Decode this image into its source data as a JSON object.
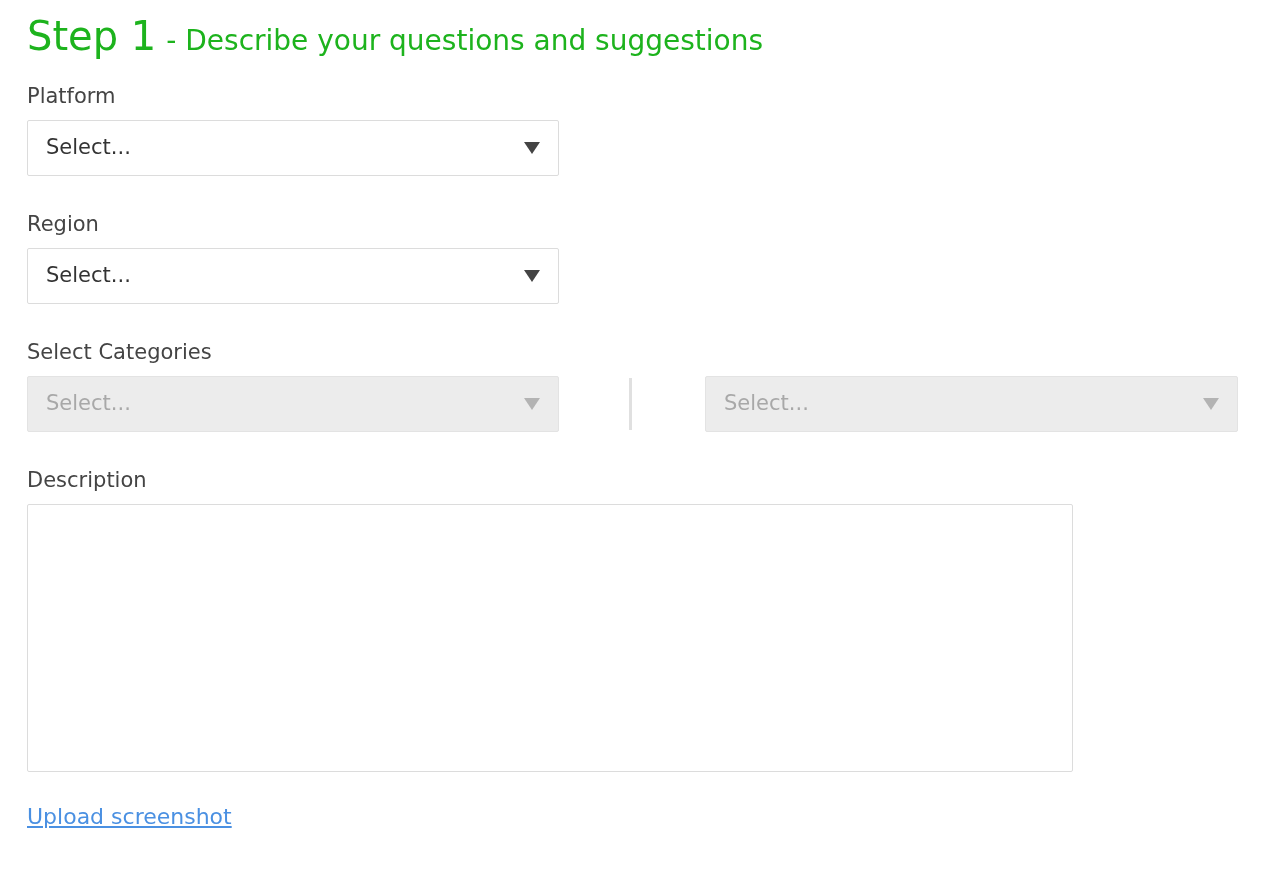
{
  "heading": {
    "step": "Step 1",
    "subtitle": "- Describe your questions and suggestions"
  },
  "fields": [
    {
      "kind": "select",
      "label": "Platform",
      "selects": [
        {
          "placeholder": "Select...",
          "disabled": false
        }
      ]
    },
    {
      "kind": "select",
      "label": "Region",
      "selects": [
        {
          "placeholder": "Select...",
          "disabled": false
        }
      ]
    },
    {
      "kind": "select",
      "label": "Select Categories",
      "selects": [
        {
          "placeholder": "Select...",
          "disabled": true
        },
        {
          "placeholder": "Select...",
          "disabled": true
        }
      ]
    },
    {
      "kind": "textarea",
      "label": "Description"
    }
  ],
  "upload_link": "Upload screenshot"
}
